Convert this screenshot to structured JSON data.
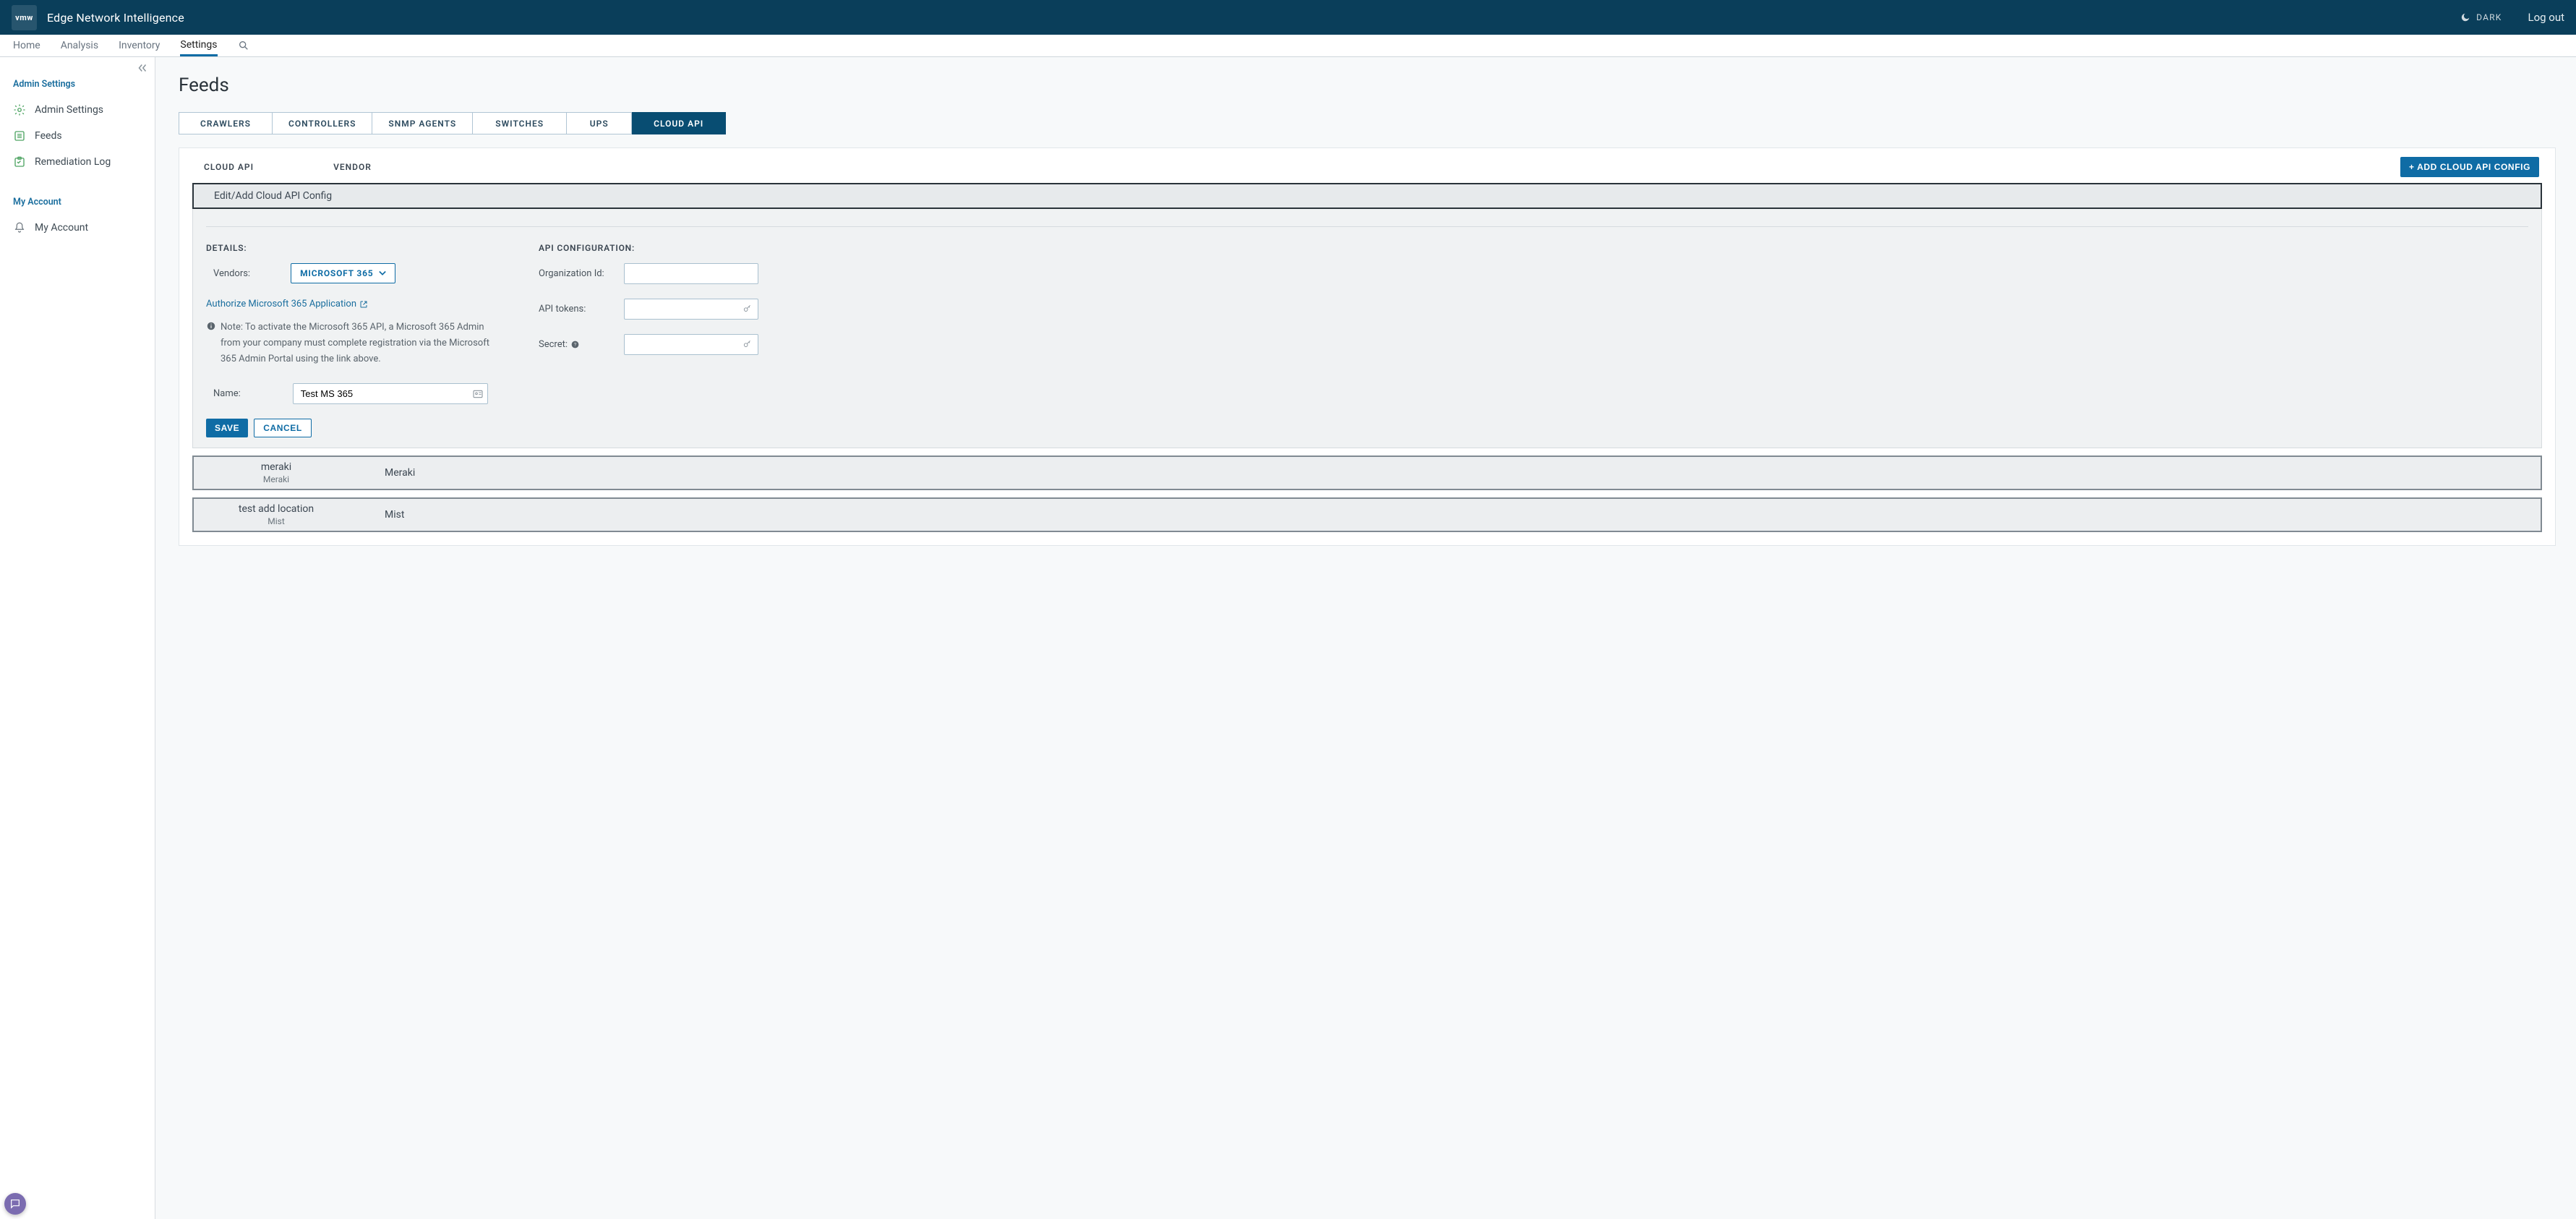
{
  "header": {
    "logo_text": "vmw",
    "app_title": "Edge Network Intelligence",
    "theme_label": "DARK",
    "logout": "Log out"
  },
  "nav": {
    "items": [
      "Home",
      "Analysis",
      "Inventory",
      "Settings"
    ],
    "active_index": 3
  },
  "sidebar": {
    "section_admin": "Admin Settings",
    "items_admin": [
      "Admin Settings",
      "Feeds",
      "Remediation Log"
    ],
    "section_account": "My Account",
    "items_account": [
      "My Account"
    ]
  },
  "page": {
    "title": "Feeds"
  },
  "top_tabs": {
    "items": [
      "CRAWLERS",
      "CONTROLLERS",
      "SNMP AGENTS",
      "SWITCHES",
      "UPS",
      "CLOUD API"
    ],
    "active_index": 5
  },
  "panel": {
    "col_headers": [
      "CLOUD API",
      "VENDOR"
    ],
    "add_button": "+ ADD CLOUD API CONFIG",
    "edit_banner": "Edit/Add Cloud API Config"
  },
  "form": {
    "details_label": "DETAILS:",
    "vendors_label": "Vendors:",
    "vendor_selected": "MICROSOFT 365",
    "auth_link": "Authorize Microsoft 365 Application",
    "note_prefix": "Note:",
    "note_body": "To activate the Microsoft 365 API, a Microsoft 365 Admin from your company must complete registration via the Microsoft 365 Admin Portal using the link above.",
    "name_label": "Name:",
    "name_value": "Test MS 365",
    "api_label": "API CONFIGURATION:",
    "org_label": "Organization Id:",
    "org_value": "",
    "tokens_label": "API tokens:",
    "tokens_value": "",
    "secret_label": "Secret:",
    "secret_value": "",
    "save": "SAVE",
    "cancel": "CANCEL"
  },
  "rows": [
    {
      "primary": "meraki",
      "secondary": "Meraki",
      "vendor": "Meraki"
    },
    {
      "primary": "test add location",
      "secondary": "Mist",
      "vendor": "Mist"
    }
  ]
}
